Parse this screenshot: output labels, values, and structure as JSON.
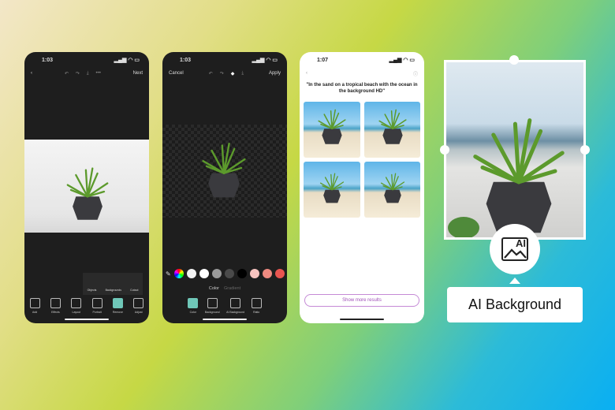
{
  "phone1": {
    "time": "1:03",
    "next": "Next",
    "popup": [
      {
        "label": "Objects"
      },
      {
        "label": "Backgrounds"
      },
      {
        "label": "Cutout"
      }
    ],
    "tools": [
      {
        "label": "Add"
      },
      {
        "label": "Effects"
      },
      {
        "label": "Layout"
      },
      {
        "label": "Portrait"
      },
      {
        "label": "Remove"
      },
      {
        "label": "Adjust"
      }
    ]
  },
  "phone2": {
    "time": "1:03",
    "cancel": "Cancel",
    "apply": "Apply",
    "tab_color": "Color",
    "tab_gradient": "Gradient",
    "swatches": [
      "#f2f2f2",
      "#ffffff",
      "#9a9a9a",
      "#4a4a4a",
      "#000000",
      "#f7c4c0",
      "#ee8a80",
      "#e85550"
    ],
    "tools": [
      {
        "label": "Color"
      },
      {
        "label": "Background"
      },
      {
        "label": "AI Background"
      },
      {
        "label": "Ratio"
      }
    ]
  },
  "phone3": {
    "time": "1:07",
    "prompt": "\"In the sand on a tropical beach with the ocean in the background HD\"",
    "show_more": "Show more results"
  },
  "callout": {
    "label": "AI Background",
    "icon_text": "AI"
  },
  "colors": {
    "accent": "#6fc7b8",
    "badge": "#c040c0"
  }
}
